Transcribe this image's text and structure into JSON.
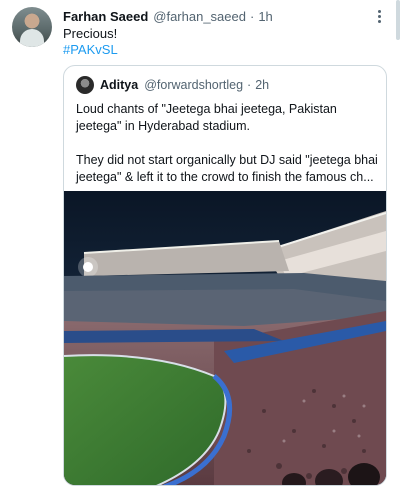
{
  "tweet": {
    "display_name": "Farhan Saeed",
    "handle": "@farhan_saeed",
    "separator": "·",
    "time": "1h",
    "text": "Precious!",
    "hashtag": "#PAKvSL"
  },
  "quoted_tweet": {
    "display_name": "Aditya",
    "handle": "@forwardshortleg",
    "separator": "·",
    "time": "2h",
    "paragraph_1": "Loud chants of \"Jeetega bhai jeetega, Pakistan jeetega\" in Hyderabad stadium.",
    "paragraph_2": "They did not start organically but DJ said \"jeetega bhai jeetega\" & left it to the crowd to finish the famous ch..."
  },
  "colors": {
    "text_primary": "#0f1419",
    "text_secondary": "#536471",
    "link": "#1d9bf0",
    "border": "#cfd9de"
  },
  "icons": {
    "more": "more-vertical-icon"
  }
}
